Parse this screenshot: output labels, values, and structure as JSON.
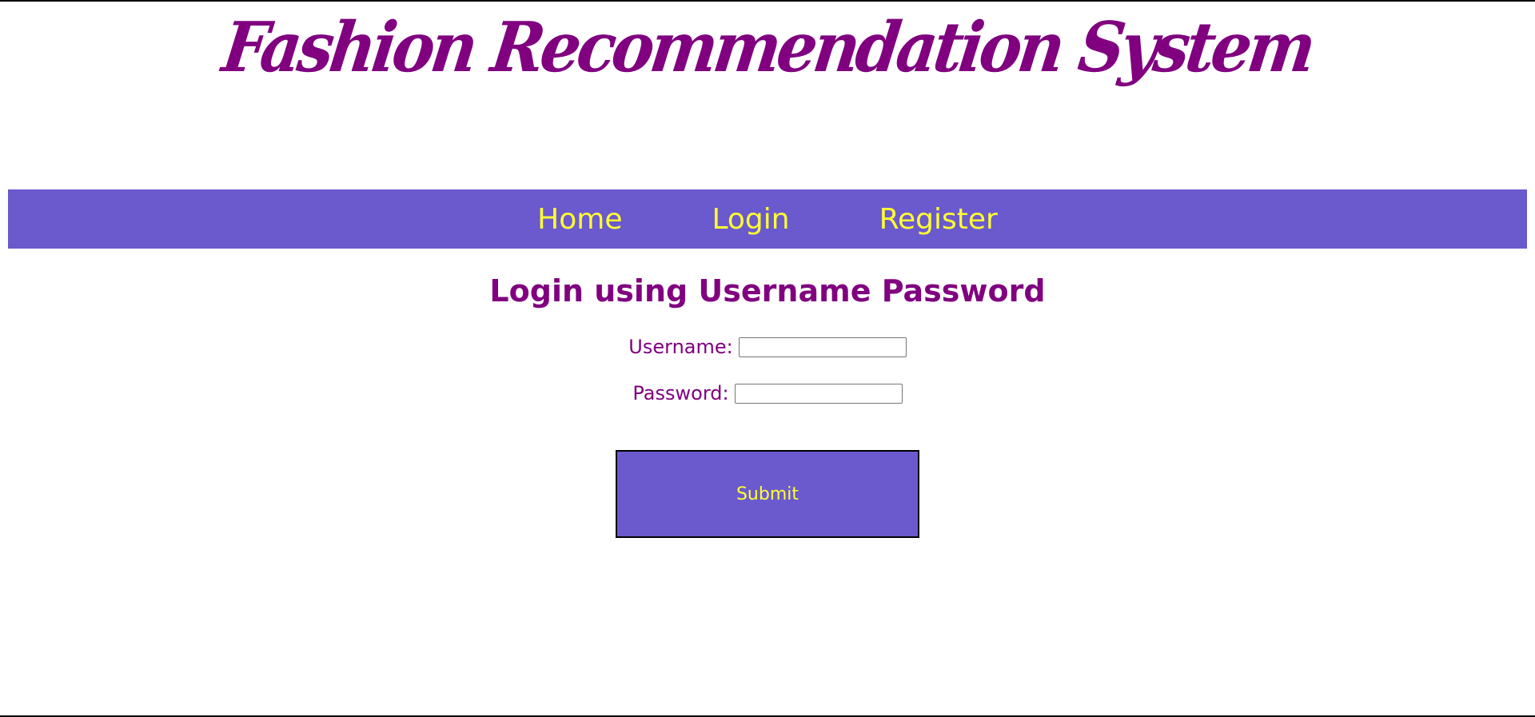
{
  "banner": {
    "title": "Fashion Recommendation System"
  },
  "nav": {
    "items": [
      {
        "label": "Home"
      },
      {
        "label": "Login"
      },
      {
        "label": "Register"
      }
    ]
  },
  "login": {
    "heading": "Login using Username Password",
    "username": {
      "label": "Username:",
      "value": "",
      "placeholder": ""
    },
    "password": {
      "label": "Password:",
      "value": "",
      "placeholder": ""
    },
    "submit_label": "Submit"
  },
  "colors": {
    "title_purple": "#800080",
    "nav_background": "#6a5acd",
    "nav_text_yellow": "#ffff33",
    "page_background": "#ffffff"
  }
}
